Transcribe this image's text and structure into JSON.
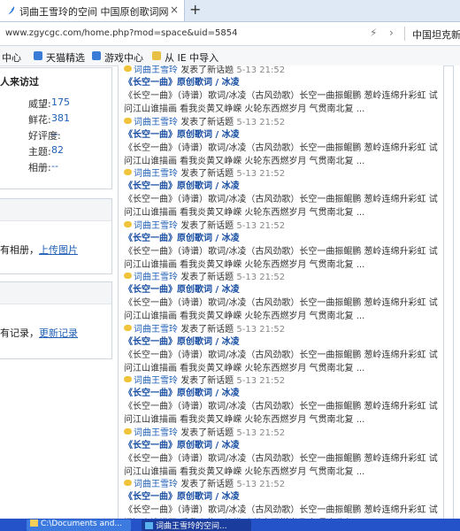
{
  "browser": {
    "tab_title": "词曲王雪玲的空间  中国原创歌词网",
    "tab_close": "×",
    "new_tab": "+",
    "url": "www.zgycgc.com/home.php?mod=space&uid=5854",
    "search_text": "中国坦克新",
    "bolt_icon": "⚡",
    "chevron_icon": "›"
  },
  "favorites": [
    {
      "label": "中心",
      "icon": "none"
    },
    {
      "label": "天猫精选",
      "icon": "page",
      "color": "#3a7bd5"
    },
    {
      "label": "游戏中心",
      "icon": "page",
      "color": "#3a7bd5"
    },
    {
      "label": "从 IE 中导入",
      "icon": "folder",
      "color": "#e9c046"
    }
  ],
  "sidebar": {
    "visitors_heading": "人来访过",
    "stats": [
      {
        "label": "威望:",
        "value": "175"
      },
      {
        "label": "鲜花:",
        "value": "381"
      },
      {
        "label": "好评度:",
        "value": "--"
      },
      {
        "label": "主题:",
        "value": "82"
      },
      {
        "label": "相册:",
        "value": "--"
      }
    ],
    "album_text_prefix": "有相册，",
    "album_link": "上传图片",
    "record_text_prefix": "有记录，",
    "record_link": "更新记录"
  },
  "feed": {
    "first_action_partial": "发表了新话题",
    "items": [
      {
        "user": "词曲王雪玲",
        "action": "发表了新话题",
        "time": "5-13 21:52",
        "title": "《长空一曲》原创歌词 / 冰凌",
        "line1": "《长空一曲》（诗谱）歌词/冰凌（古风劲歌）长空一曲振鲲鹏 葱岭连绵升彩虹 试",
        "line2": "问江山谁描画 看我炎黄又峥嵘 火轮东西燃岁月 气贯南北复 ..."
      },
      {
        "user": "词曲王雪玲",
        "action": "发表了新话题",
        "time": "5-13 21:52",
        "title": "《长空一曲》原创歌词 / 冰凌",
        "line1": "《长空一曲》（诗谱）歌词/冰凌（古风劲歌）长空一曲振鲲鹏 葱岭连绵升彩虹 试",
        "line2": "问江山谁描画 看我炎黄又峥嵘 火轮东西燃岁月 气贯南北复 ..."
      },
      {
        "user": "词曲王雪玲",
        "action": "发表了新话题",
        "time": "5-13 21:52",
        "title": "《长空一曲》原创歌词 / 冰凌",
        "line1": "《长空一曲》（诗谱）歌词/冰凌（古风劲歌）长空一曲振鲲鹏 葱岭连绵升彩虹 试",
        "line2": "问江山谁描画 看我炎黄又峥嵘 火轮东西燃岁月 气贯南北复 ..."
      },
      {
        "user": "词曲王雪玲",
        "action": "发表了新话题",
        "time": "5-13 21:52",
        "title": "《长空一曲》原创歌词 / 冰凌",
        "line1": "《长空一曲》（诗谱）歌词/冰凌（古风劲歌）长空一曲振鲲鹏 葱岭连绵升彩虹 试",
        "line2": "问江山谁描画 看我炎黄又峥嵘 火轮东西燃岁月 气贯南北复 ..."
      },
      {
        "user": "词曲王雪玲",
        "action": "发表了新话题",
        "time": "5-13 21:52",
        "title": "《长空一曲》原创歌词 / 冰凌",
        "line1": "《长空一曲》（诗谱）歌词/冰凌（古风劲歌）长空一曲振鲲鹏 葱岭连绵升彩虹 试",
        "line2": "问江山谁描画 看我炎黄又峥嵘 火轮东西燃岁月 气贯南北复 ..."
      },
      {
        "user": "词曲王雪玲",
        "action": "发表了新话题",
        "time": "5-13 21:52",
        "title": "《长空一曲》原创歌词 / 冰凌",
        "line1": "《长空一曲》（诗谱）歌词/冰凌（古风劲歌）长空一曲振鲲鹏 葱岭连绵升彩虹 试",
        "line2": "问江山谁描画 看我炎黄又峥嵘 火轮东西燃岁月 气贯南北复 ..."
      },
      {
        "user": "词曲王雪玲",
        "action": "发表了新话题",
        "time": "5-13 21:52",
        "title": "《长空一曲》原创歌词 / 冰凌",
        "line1": "《长空一曲》（诗谱）歌词/冰凌（古风劲歌）长空一曲振鲲鹏 葱岭连绵升彩虹 试",
        "line2": "问江山谁描画 看我炎黄又峥嵘 火轮东西燃岁月 气贯南北复 ..."
      },
      {
        "user": "词曲王雪玲",
        "action": "发表了新话题",
        "time": "5-13 21:52",
        "title": "《长空一曲》原创歌词 / 冰凌",
        "line1": "《长空一曲》（诗谱）歌词/冰凌（古风劲歌）长空一曲振鲲鹏 葱岭连绵升彩虹 试",
        "line2": "问江山谁描画 看我炎黄又峥嵘 火轮东西燃岁月 气贯南北复 ..."
      },
      {
        "user": "词曲王雪玲",
        "action": "发表了新话题",
        "time": "5-13 21:52",
        "title": "《长空一曲》原创歌词 / 冰凌",
        "line1": "《长空一曲》（诗谱）歌词/冰凌（古风劲歌）长空一曲振鲲鹏 葱岭连绵升彩虹 试",
        "line2": "问江山谁描画 看我炎黄又峥嵘 火轮东西燃岁月 气贯南北复 ..."
      }
    ]
  },
  "taskbar": {
    "items": [
      {
        "label": "C:\\Documents and..."
      },
      {
        "label": "词曲王雪玲的空间..."
      }
    ]
  }
}
